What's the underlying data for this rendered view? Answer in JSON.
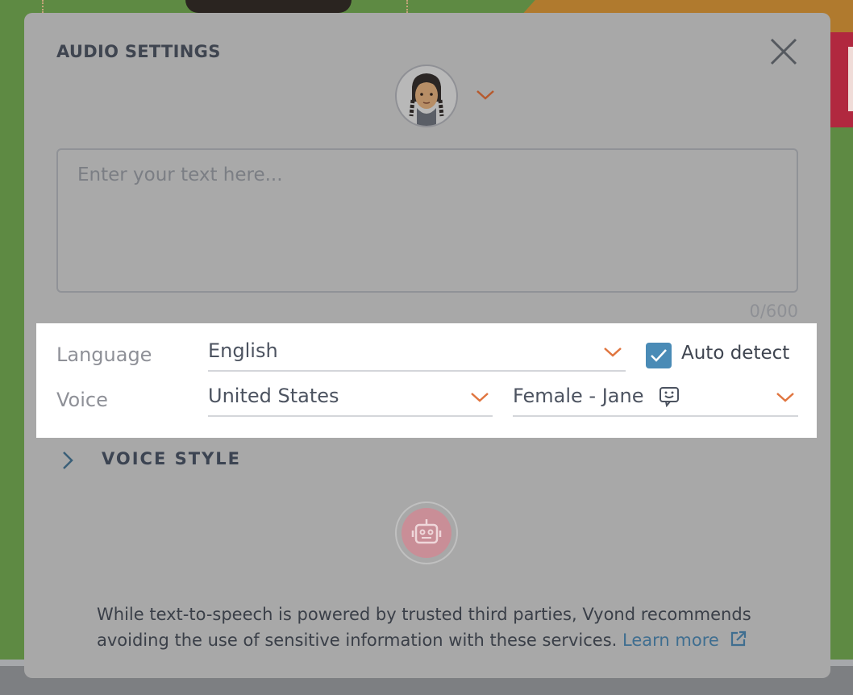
{
  "dialog": {
    "title": "AUDIO SETTINGS",
    "textarea_placeholder": "Enter your text here...",
    "char_counter": "0/600"
  },
  "settings": {
    "language_label": "Language",
    "language_value": "English",
    "auto_detect_label": "Auto detect",
    "auto_detect_checked": true,
    "voice_label": "Voice",
    "accent_value": "United States",
    "voice_value": "Female - Jane"
  },
  "voice_style": {
    "label": "VOICE STYLE"
  },
  "disclaimer": {
    "text": "While text-to-speech is powered by trusted third parties, Vyond recommends avoiding the use of sensitive information with these services.",
    "link_label": "Learn more"
  },
  "colors": {
    "accent_orange": "#e0753f",
    "checkbox_blue": "#4a8bb6",
    "link_blue": "#3f6e90",
    "robot_pink": "#c98e97"
  },
  "icons": [
    "close-icon",
    "chevron-down-icon",
    "check-icon",
    "voice-bubble-icon",
    "chevron-right-icon",
    "robot-icon",
    "external-link-icon"
  ]
}
